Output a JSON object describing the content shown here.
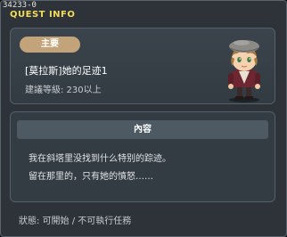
{
  "window": {
    "id_label": "34233-0",
    "title": "QUEST INFO"
  },
  "quest": {
    "tag": "主要",
    "name": "[莫拉斯]她的足迹1",
    "level_text": "建議等級: 230以上",
    "npc_icon": "npc-portrait-icon"
  },
  "content": {
    "header": "內容",
    "lines": [
      "我在斜塔里没找到什么特别的踪迹。",
      "留在那里的，只有她的憤怒……"
    ]
  },
  "status": {
    "text": "狀態: 可開始 / 不可執行任務"
  },
  "colors": {
    "title": "#f2dc5a",
    "tag_bg": "#c2a37a",
    "panel_bg": "#2d3339",
    "card_bg": "#3b444c"
  }
}
